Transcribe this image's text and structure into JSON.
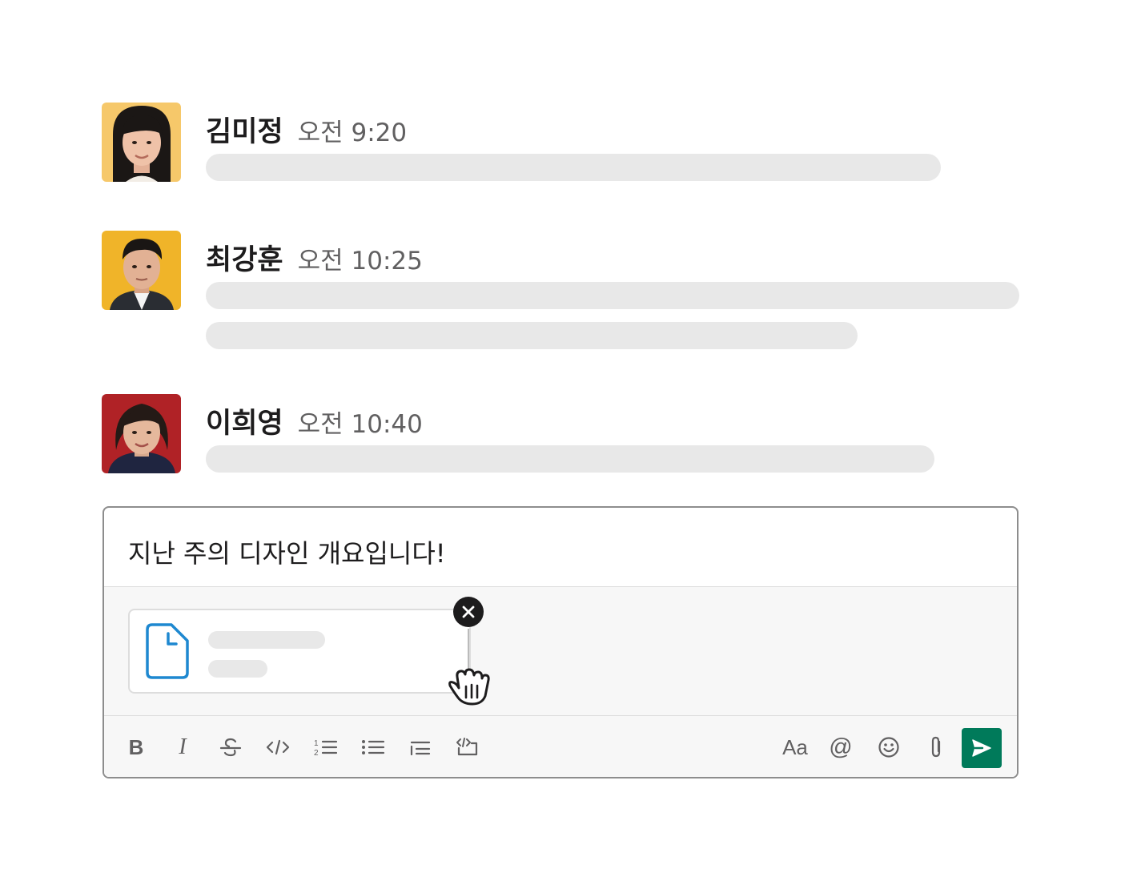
{
  "messages": [
    {
      "name": "김미정",
      "time": "오전 9:20",
      "avatar": "avatar-woman-1",
      "avatar_bg": "#f5c765"
    },
    {
      "name": "최강훈",
      "time": "오전 10:25",
      "avatar": "avatar-man-1",
      "avatar_bg": "#f0b429"
    },
    {
      "name": "이희영",
      "time": "오전 10:40",
      "avatar": "avatar-woman-2",
      "avatar_bg": "#b02226"
    }
  ],
  "composer": {
    "text": "지난 주의 디자인 개요입니다!",
    "attachment": {
      "icon": "document-icon",
      "remove_icon": "close-icon",
      "cursor": "grab-hand-cursor"
    }
  },
  "toolbar": {
    "bold": "B",
    "italic": "I",
    "format_text_label": "Aa",
    "mention_label": "@",
    "icons": [
      "bold-icon",
      "italic-icon",
      "strikethrough-icon",
      "code-icon",
      "ordered-list-icon",
      "bullet-list-icon",
      "blockquote-icon",
      "code-block-icon",
      "format-text-icon",
      "mention-icon",
      "emoji-icon",
      "attach-icon",
      "send-icon"
    ]
  },
  "colors": {
    "send_button": "#007a5a",
    "placeholder_bar": "#e8e8e8",
    "file_icon": "#1e88d0",
    "border": "#8d8d8d"
  }
}
